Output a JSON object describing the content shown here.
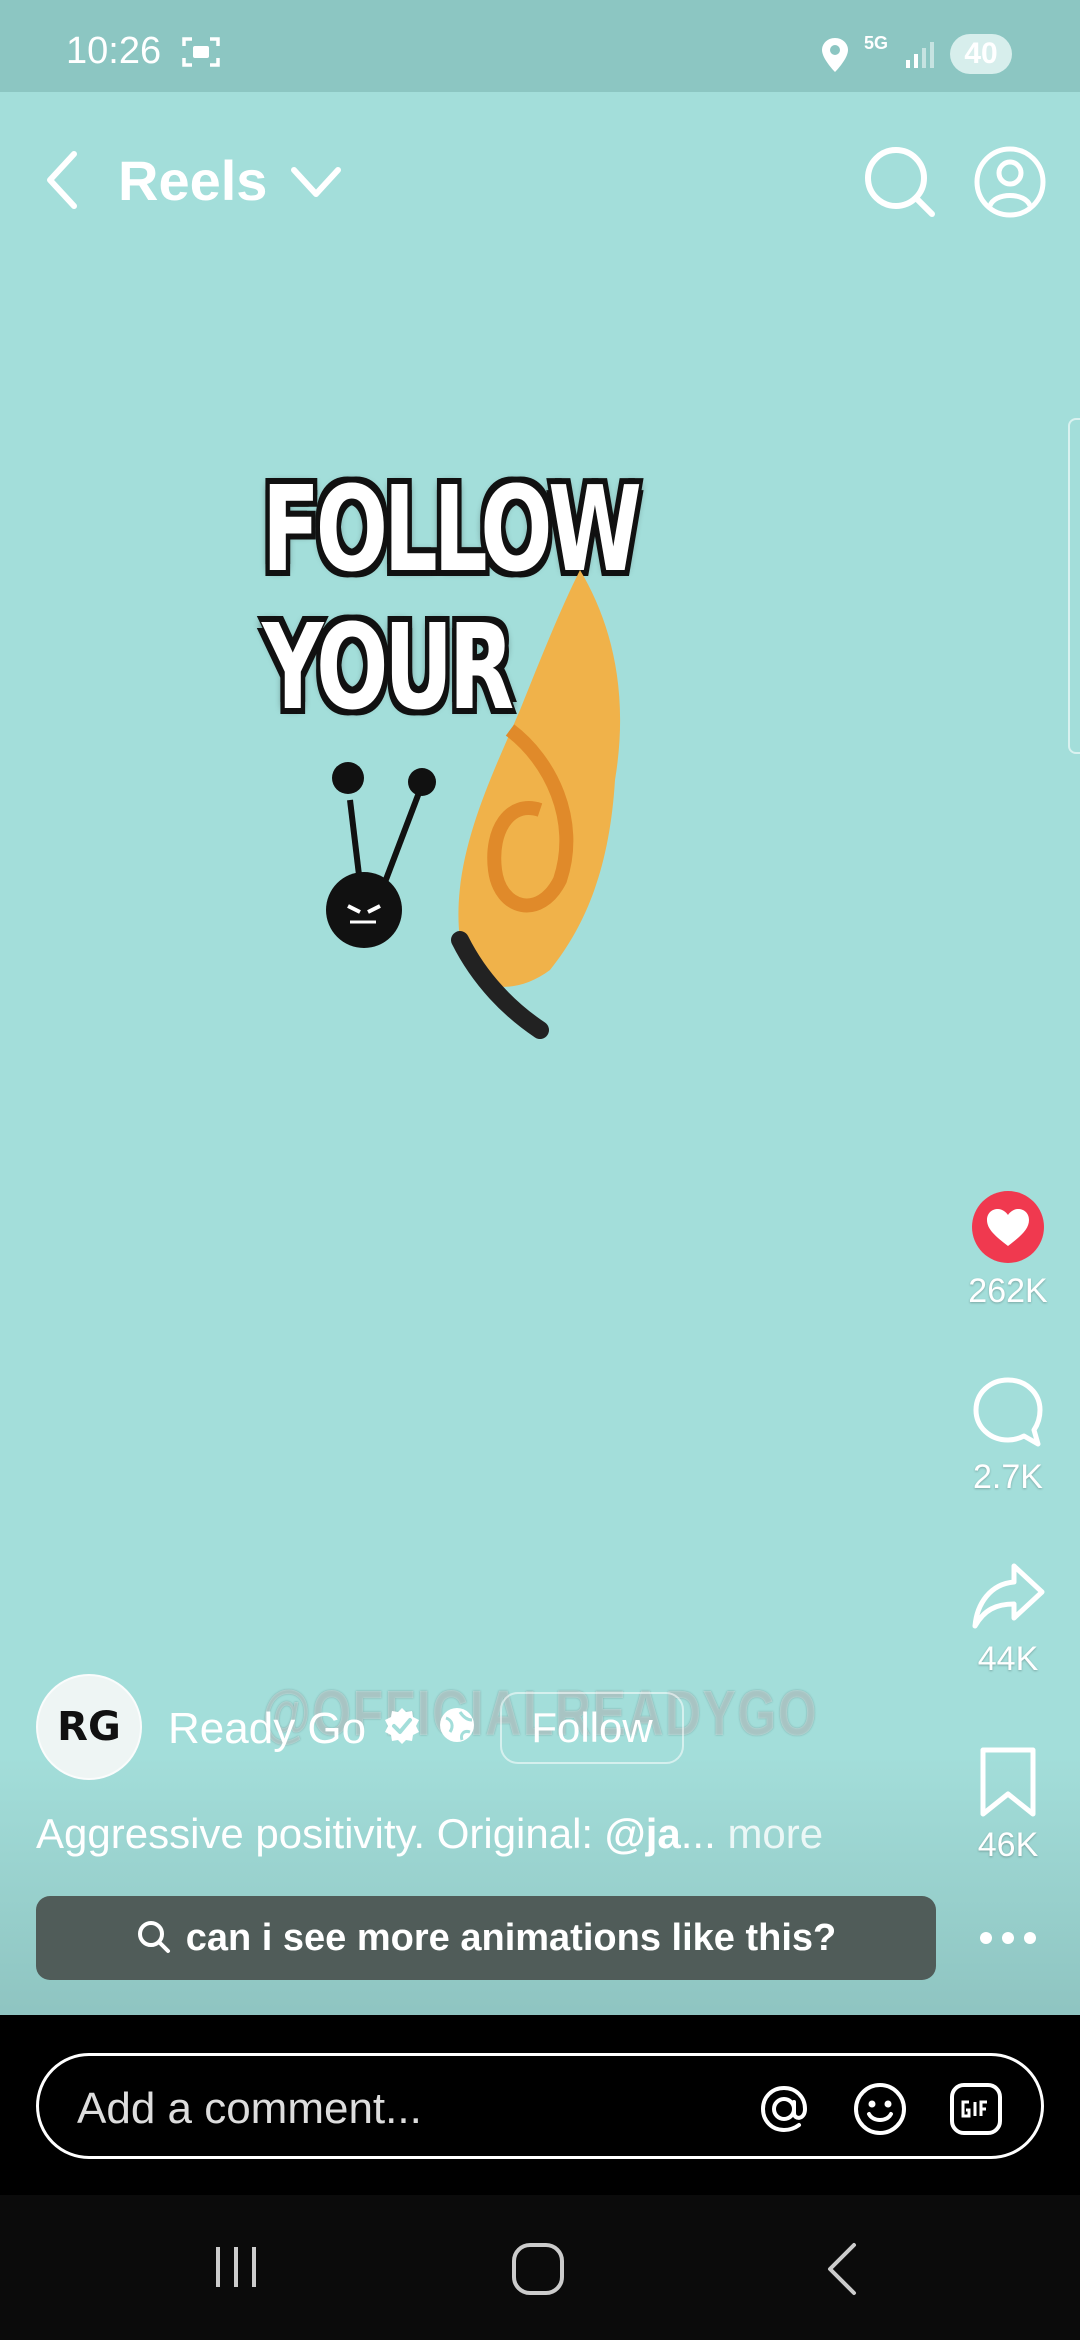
{
  "status_bar": {
    "time": "10:26",
    "network": "5G",
    "battery": "40"
  },
  "header": {
    "title": "Reels"
  },
  "video": {
    "overlay_text": "FOLLOW YOUR",
    "watermark": "@OFFICIALREADYGO"
  },
  "actions": {
    "likes": "262K",
    "comments": "2.7K",
    "shares": "44K",
    "saves": "46K"
  },
  "author": {
    "avatar_text": "RG",
    "name": "Ready Go",
    "follow_label": "Follow"
  },
  "caption": {
    "text": "Aggressive positivity. Original: ",
    "mention": "@ja",
    "ellipsis": "...",
    "more": "more"
  },
  "search_suggestion": {
    "text": "can i see more animations like this?"
  },
  "comment": {
    "placeholder": "Add a comment..."
  },
  "colors": {
    "background": "#a3deda",
    "status_bar": "#8cc6c2",
    "like_red": "#f0394f",
    "suggestion_bg": "#505c59"
  }
}
